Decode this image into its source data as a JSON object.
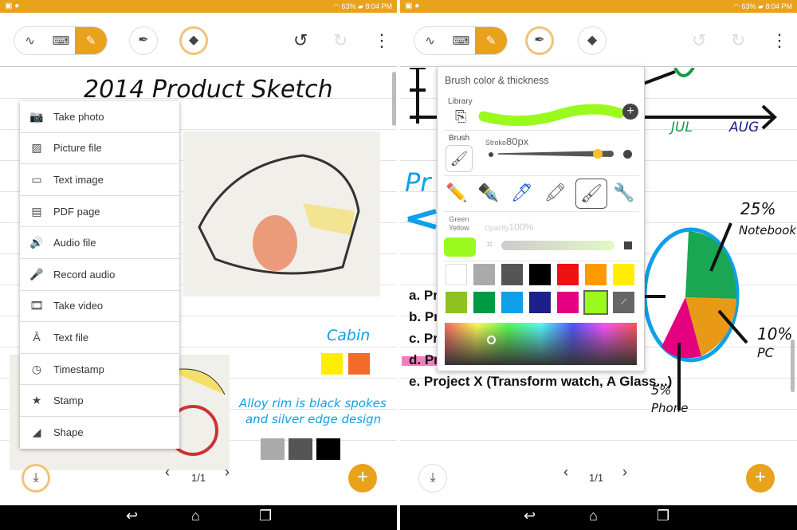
{
  "status": {
    "battery": "63%",
    "time": "8:04 PM"
  },
  "left": {
    "title": "2014 Product Sketch",
    "menu": [
      {
        "icon": "camera-icon",
        "label": "Take photo"
      },
      {
        "icon": "picture-icon",
        "label": "Picture file"
      },
      {
        "icon": "text-image-icon",
        "label": "Text image"
      },
      {
        "icon": "pdf-icon",
        "label": "PDF page"
      },
      {
        "icon": "audio-icon",
        "label": "Audio file"
      },
      {
        "icon": "microphone-icon",
        "label": "Record audio"
      },
      {
        "icon": "video-icon",
        "label": "Take video"
      },
      {
        "icon": "text-file-icon",
        "label": "Text file"
      },
      {
        "icon": "clock-icon",
        "label": "Timestamp"
      },
      {
        "icon": "stamp-icon",
        "label": "Stamp"
      },
      {
        "icon": "shape-icon",
        "label": "Shape"
      }
    ],
    "cabin": "Cabin",
    "note": "Alloy rim is black spokes",
    "note2": "and silver edge design",
    "page": "1/1"
  },
  "right": {
    "popup": {
      "title": "Brush color & thickness",
      "library": "Library",
      "brush": "Brush",
      "stroke_label": "Stroke",
      "stroke": "80px",
      "stroke_fraction": 0.9,
      "color_name_1": "Green",
      "color_name_2": "Yellow",
      "opacity_label": "Opacity",
      "opacity": "100%",
      "current_color": "#9afa1e",
      "palette": [
        "#ffffff",
        "#aaaaaa",
        "#555555",
        "#000000",
        "#ee1111",
        "#ff9900",
        "#ffee00",
        "#8dc21f",
        "#009944",
        "#0ea0e8",
        "#1d2088",
        "#e4007f",
        "#9afa1e"
      ]
    },
    "chart": {
      "jul": "JUL",
      "aug": "AUG",
      "notebook_pct": "25%",
      "notebook": "Notebook",
      "pc_pct": "10%",
      "pc": "PC",
      "phone_pct": "5%",
      "phone": "Phone"
    },
    "list": [
      "a. Pr",
      "b. Pr",
      "c. Pr",
      "d. Pr",
      "e. Project X (Transform watch, A Glass...)"
    ],
    "page": "1/1"
  },
  "colors": {
    "accent": "#e8a21c"
  }
}
